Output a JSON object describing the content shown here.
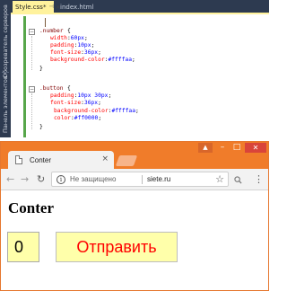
{
  "editor": {
    "side_tabs": [
      "Обозреватель серверов",
      "Панель элементов"
    ],
    "tabs": [
      {
        "label": "Style.css*",
        "active": true
      },
      {
        "label": "index.html",
        "active": false
      }
    ],
    "code": {
      "number_selector": ".number",
      "number_rules": [
        {
          "prop": "width",
          "value": "60px"
        },
        {
          "prop": "padding",
          "value": "10px"
        },
        {
          "prop": "font-size",
          "value": "36px"
        },
        {
          "prop": "background-color",
          "value": "#ffffaa"
        }
      ],
      "button_selector": ".button",
      "button_rules": [
        {
          "prop": "padding",
          "value": "10px 30px"
        },
        {
          "prop": "font-size",
          "value": "36px"
        },
        {
          "prop": "background-color",
          "value": "#ffffaa"
        },
        {
          "prop": "color",
          "value": "#ff0000"
        }
      ],
      "open_brace": "{",
      "close_brace": "}"
    }
  },
  "browser": {
    "tab_title": "Conter",
    "security_text": "Не защищено",
    "url": "siete.ru",
    "colors": {
      "frame": "#f07c2a",
      "close": "#d9443a"
    },
    "page": {
      "heading": "Conter",
      "number_value": "0",
      "button_label": "Отправить",
      "colors": {
        "field_bg": "#ffffaa",
        "button_text": "#ff0000"
      }
    }
  }
}
